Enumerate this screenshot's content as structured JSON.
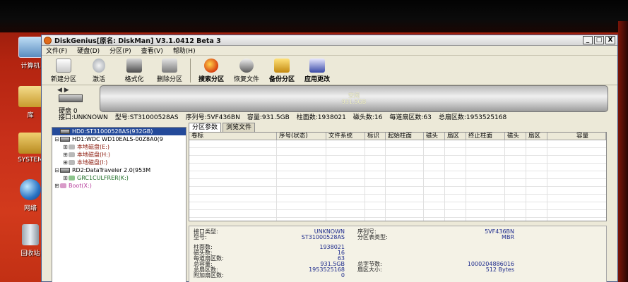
{
  "desktop": {
    "icons": [
      {
        "label": "计算机",
        "icon": "computer-icon"
      },
      {
        "label": "库",
        "icon": "library-folder-icon"
      },
      {
        "label": "SYSTEM",
        "icon": "folder-user-icon"
      },
      {
        "label": "网络",
        "icon": "network-globe-icon"
      },
      {
        "label": "回收站",
        "icon": "recycle-bin-icon"
      }
    ]
  },
  "window": {
    "title": "DiskGenius[原名: DiskMan] V3.1.0412 Beta 3",
    "controls": [
      "_",
      "□",
      "X"
    ]
  },
  "menu": [
    "文件(F)",
    "硬盘(D)",
    "分区(P)",
    "查看(V)",
    "帮助(H)"
  ],
  "toolbar": [
    {
      "label": "新建分区",
      "icon": "new-partition-icon"
    },
    {
      "label": "激活",
      "icon": "activate-icon"
    },
    {
      "label": "格式化",
      "icon": "format-icon"
    },
    {
      "label": "删除分区",
      "icon": "delete-partition-icon"
    },
    {
      "label": "搜索分区",
      "icon": "search-partition-icon"
    },
    {
      "label": "恢复文件",
      "icon": "recover-files-icon"
    },
    {
      "label": "备份分区",
      "icon": "backup-partition-icon"
    },
    {
      "label": "应用更改",
      "icon": "apply-changes-icon"
    }
  ],
  "diskbar": {
    "nav_left": "◀",
    "nav_right": "▶",
    "disk_label": "硬盘 0",
    "partition_text_1": "空闲",
    "partition_text_2": "931.5GB"
  },
  "infoline": {
    "interface": "接口:UNKNOWN",
    "model": "型号:ST31000528AS",
    "serial": "序列号:5VF436BN",
    "capacity": "容量:931.5GB",
    "cylinders": "柱面数:1938021",
    "heads": "磁头数:16",
    "sectors_per_track": "每道扇区数:63",
    "total_sectors": "总扇区数:1953525168"
  },
  "tree": [
    {
      "indent": 0,
      "expander": "",
      "kind": "disk",
      "text": "HD0:ST31000528AS(932GB)",
      "selected": true,
      "color": ""
    },
    {
      "indent": 0,
      "expander": "⊟",
      "kind": "disk",
      "text": "HD1:WDC WD10EALS-00Z8A0(9",
      "selected": false,
      "color": ""
    },
    {
      "indent": 1,
      "expander": "⊞",
      "kind": "part",
      "text": "本地磁盘(E:)",
      "selected": false,
      "color": "red"
    },
    {
      "indent": 1,
      "expander": "⊞",
      "kind": "part",
      "text": "本地磁盘(H:)",
      "selected": false,
      "color": "red"
    },
    {
      "indent": 1,
      "expander": "⊞",
      "kind": "part",
      "text": "本地磁盘(I:)",
      "selected": false,
      "color": "red"
    },
    {
      "indent": 0,
      "expander": "⊟",
      "kind": "disk",
      "text": "RD2:DataTraveler 2.0(953M",
      "selected": false,
      "color": ""
    },
    {
      "indent": 1,
      "expander": "⊞",
      "kind": "part",
      "text": "GRC1CULFRER(K:)",
      "selected": false,
      "color": "green"
    },
    {
      "indent": 0,
      "expander": "⊞",
      "kind": "part",
      "text": "Boot(X:)",
      "selected": false,
      "color": "pink"
    }
  ],
  "tabs": [
    "分区参数",
    "浏览文件"
  ],
  "grid_columns": [
    "卷标",
    "序号(状态)",
    "文件系统",
    "标识",
    "起始柱面",
    "磁头",
    "扇区",
    "终止柱面",
    "磁头",
    "扇区",
    "容量"
  ],
  "details": {
    "interface_label": "接口类型:",
    "interface_value": "UNKNOWN",
    "model_label": "型号:",
    "model_value": "ST31000528AS",
    "serial_label": "序列号:",
    "serial_value": "5VF436BN",
    "ptable_label": "分区表类型:",
    "ptable_value": "MBR",
    "cyl_label": "柱面数:",
    "cyl_value": "1938021",
    "heads_label": "磁头数:",
    "heads_value": "16",
    "spt_label": "每道扇区数:",
    "spt_value": "63",
    "cap_label": "总容量:",
    "cap_value": "931.5GB",
    "totbytes_label": "总字节数:",
    "totbytes_value": "1000204886016",
    "totsec_label": "总扇区数:",
    "totsec_value": "1953525168",
    "secsize_label": "扇区大小:",
    "secsize_value": "512 Bytes",
    "extra_label": "附加扇区数:",
    "extra_value": "0"
  }
}
